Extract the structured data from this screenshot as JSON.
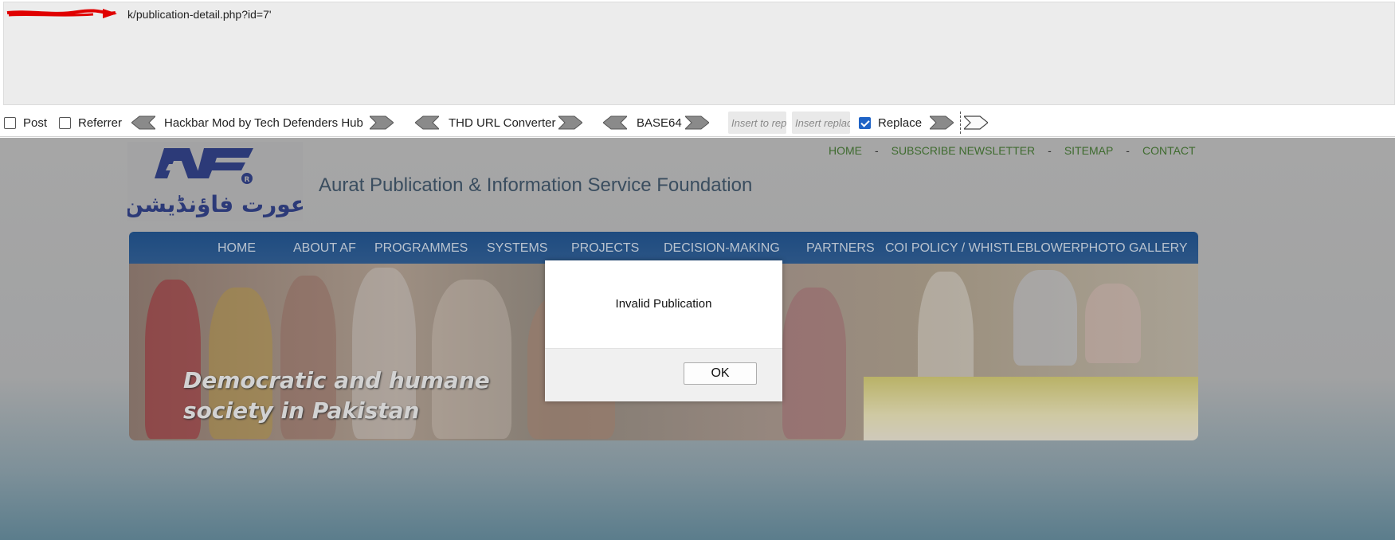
{
  "hackbar": {
    "url_text": "k/publication-detail.php?id=7'",
    "post_label": "Post",
    "referrer_label": "Referrer",
    "title_label": "Hackbar Mod by Tech Defenders Hub",
    "url_converter_label": "THD URL Converter",
    "base64_label": "BASE64",
    "insert_to_replace_placeholder": "Insert to rep",
    "insert_replacement_placeholder": "Insert replac",
    "replace_label": "Replace",
    "replace_checked": true,
    "post_checked": false,
    "referrer_checked": false
  },
  "site": {
    "top_nav": [
      "HOME",
      "SUBSCRIBE NEWSLETTER",
      "SITEMAP",
      "CONTACT"
    ],
    "top_nav_separator": "-",
    "logo_urdu": "عورت فاؤنڈیشن",
    "logo_mark": "AF",
    "title": "Aurat Publication & Information Service Foundation",
    "main_nav": [
      "HOME",
      "ABOUT AF",
      "PROGRAMMES",
      "SYSTEMS",
      "PROJECTS",
      "DECISION-MAKING",
      "PARTNERS",
      "COI POLICY / WHISTLEBLOWER",
      "PHOTO GALLERY"
    ],
    "banner_line1": "Democratic and humane",
    "banner_line2": "society in Pakistan"
  },
  "dialog": {
    "message": "Invalid Publication",
    "ok_label": "OK"
  },
  "colors": {
    "nav_bg": "#1e4b80",
    "top_nav_text": "#3e6b2e",
    "checkbox_checked": "#1f63c6"
  }
}
